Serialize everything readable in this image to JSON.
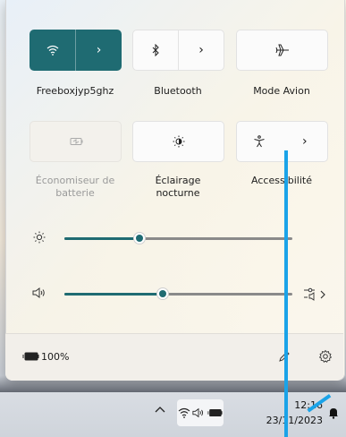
{
  "quick_settings": {
    "tiles": [
      {
        "label": "Freeboxjyp5ghz",
        "icon": "wifi-icon",
        "state": "on"
      },
      {
        "label": "Bluetooth",
        "icon": "bluetooth-icon",
        "state": "off"
      },
      {
        "label": "Mode Avion",
        "icon": "airplane-icon",
        "state": "off"
      },
      {
        "label": "Économiseur de batterie",
        "icon": "battery-saver-icon",
        "state": "disabled"
      },
      {
        "label": "Éclairage nocturne",
        "icon": "night-light-icon",
        "state": "off"
      },
      {
        "label": "Accessibilité",
        "icon": "accessibility-icon",
        "state": "off"
      }
    ],
    "brightness": {
      "icon": "brightness-icon",
      "level_fraction": 0.33
    },
    "volume": {
      "icon": "speaker-icon",
      "level_fraction": 0.43,
      "output_icon": "audio-output-icon"
    }
  },
  "footer": {
    "battery_icon": "battery-icon",
    "battery_text": "100%",
    "edit_icon": "pencil-icon",
    "settings_icon": "gear-icon"
  },
  "taskbar": {
    "overflow_icon": "chevron-up-icon",
    "time": "12:16",
    "date": "23/11/2023",
    "notifications_icon": "bell-icon"
  },
  "colors": {
    "accent": "#1f6b72",
    "annotation_line": "#1aa3e8"
  }
}
